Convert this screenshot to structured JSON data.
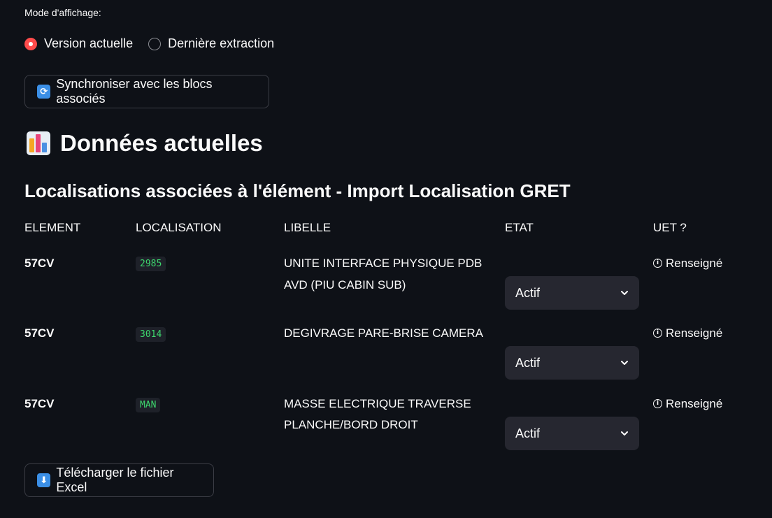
{
  "mode": {
    "label": "Mode d'affichage:",
    "options": [
      "Version actuelle",
      "Dernière extraction"
    ],
    "selected": "Version actuelle"
  },
  "sync_button": {
    "icon": "refresh-icon",
    "label": "Synchroniser avec les blocs associés"
  },
  "section_title": {
    "icon": "bar-chart-emoji",
    "text": "Données actuelles"
  },
  "subtitle": "Localisations associées à l'élément - Import Localisation GRET",
  "table": {
    "headers": [
      "ELEMENT",
      "LOCALISATION",
      "LIBELLE",
      "ETAT",
      "UET ?"
    ],
    "rows": [
      {
        "element": "57CV",
        "localisation": "2985",
        "libelle": [
          "UNITE INTERFACE PHYSIQUE PDB",
          "AVD (PIU CABIN SUB)"
        ],
        "etat": "Actif",
        "uet": "Renseigné"
      },
      {
        "element": "57CV",
        "localisation": "3014",
        "libelle": [
          "DEGIVRAGE PARE-BRISE CAMERA"
        ],
        "etat": "Actif",
        "uet": "Renseigné"
      },
      {
        "element": "57CV",
        "localisation": "MAN",
        "libelle": [
          "MASSE ELECTRIQUE TRAVERSE",
          "PLANCHE/BORD DROIT"
        ],
        "etat": "Actif",
        "uet": "Renseigné"
      }
    ]
  },
  "download_button": {
    "icon": "down-arrow-icon",
    "label": "Télécharger le fichier Excel"
  },
  "colors": {
    "background": "#0e1117",
    "accent": "#ff4b4b",
    "code_text": "#3dd56d",
    "select_bg": "#262730"
  }
}
